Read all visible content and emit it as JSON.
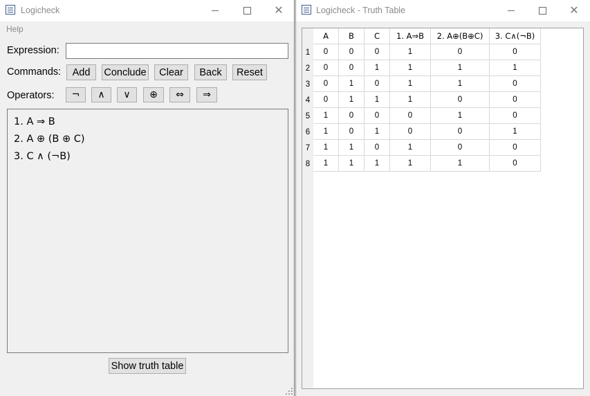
{
  "main_window": {
    "title": "Logicheck",
    "menu": [
      "Help"
    ],
    "expression_label": "Expression:",
    "expression_value": "",
    "commands_label": "Commands:",
    "commands": [
      "Add",
      "Conclude",
      "Clear",
      "Back",
      "Reset"
    ],
    "operators_label": "Operators:",
    "operators": [
      {
        "symbol": "¬",
        "icon": "not-operator-icon"
      },
      {
        "symbol": "∧",
        "icon": "and-operator-icon"
      },
      {
        "symbol": "∨",
        "icon": "or-operator-icon"
      },
      {
        "symbol": "⊕",
        "icon": "xor-operator-icon"
      },
      {
        "symbol": "⇔",
        "icon": "iff-operator-icon"
      },
      {
        "symbol": "⇒",
        "icon": "implies-operator-icon"
      }
    ],
    "premises": [
      "1. A ⇒ B",
      "2. A ⊕ (B ⊕ C)",
      "3. C ∧ (¬B)"
    ],
    "show_truth_table_label": "Show truth table"
  },
  "truth_window": {
    "title": "Logicheck - Truth Table",
    "columns": [
      "A",
      "B",
      "C",
      "1.    A⇒B",
      "2.    A⊕(B⊕C)",
      "3.    C∧(¬B)"
    ],
    "row_labels": [
      "1",
      "2",
      "3",
      "4",
      "5",
      "6",
      "7",
      "8"
    ],
    "rows": [
      [
        "0",
        "0",
        "0",
        "1",
        "0",
        "0"
      ],
      [
        "0",
        "0",
        "1",
        "1",
        "1",
        "1"
      ],
      [
        "0",
        "1",
        "0",
        "1",
        "1",
        "0"
      ],
      [
        "0",
        "1",
        "1",
        "1",
        "0",
        "0"
      ],
      [
        "1",
        "0",
        "0",
        "0",
        "1",
        "0"
      ],
      [
        "1",
        "0",
        "1",
        "0",
        "0",
        "1"
      ],
      [
        "1",
        "1",
        "0",
        "1",
        "0",
        "0"
      ],
      [
        "1",
        "1",
        "1",
        "1",
        "1",
        "0"
      ]
    ]
  },
  "window_controls": {
    "minimize": "minimize-icon",
    "maximize": "maximize-icon",
    "close": "close-icon"
  }
}
